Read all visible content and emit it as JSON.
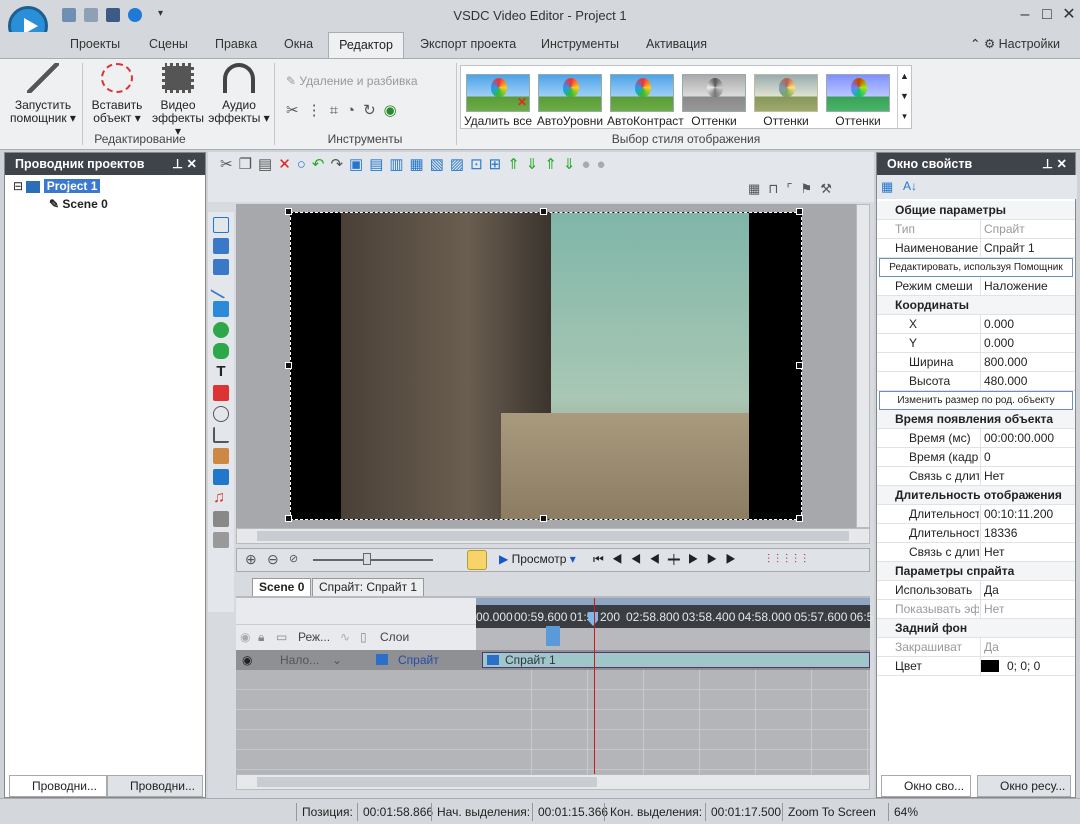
{
  "app": {
    "title": "VSDC Video Editor - Project 1"
  },
  "menu": {
    "tabs": [
      "Проекты",
      "Сцены",
      "Правка",
      "Окна",
      "Редактор",
      "Экспорт проекта",
      "Инструменты",
      "Активация"
    ],
    "settings": "Настройки"
  },
  "ribbon": {
    "wizard": "Запустить помощник",
    "insert": "Вставить объект",
    "video_fx": "Видео эффекты",
    "audio_fx": "Аудио эффекты",
    "group_edit": "Редактирование",
    "cut_split": "Удаление и разбивка",
    "group_tools": "Инструменты",
    "styles": [
      "Удалить все",
      "АвтоУровни",
      "АвтоКонтраст",
      "Оттенки",
      "Оттенки",
      "Оттенки"
    ],
    "group_styles": "Выбор стиля отображения"
  },
  "project_panel": {
    "title": "Проводник проектов",
    "root": "Project 1",
    "scene": "Scene 0",
    "tab1": "Проводни...",
    "tab2": "Проводни..."
  },
  "player": {
    "preview": "Просмотр"
  },
  "timeline": {
    "tab_scene": "Scene 0",
    "tab_sprite": "Спрайт: Спрайт 1",
    "ticks": [
      "00.000",
      "00:59.600",
      "01:5",
      "200",
      "02:58.800",
      "03:58.400",
      "04:58.000",
      "05:57.600",
      "06:5"
    ],
    "col_mode": "Реж...",
    "col_layers": "Слои",
    "track_blend": "Нало...",
    "track_name": "Спрайт",
    "clip": "Спрайт 1"
  },
  "properties": {
    "title": "Окно свойств",
    "rows": [
      {
        "type": "sec",
        "k": "Общие параметры"
      },
      {
        "type": "row",
        "k": "Тип",
        "v": "Спрайт",
        "dim": true
      },
      {
        "type": "row",
        "k": "Наименование",
        "v": "Спрайт 1"
      },
      {
        "type": "btn",
        "k": "Редактировать, используя Помощник"
      },
      {
        "type": "row",
        "k": "Режим смеши",
        "v": "Наложение"
      },
      {
        "type": "sec",
        "k": "Координаты"
      },
      {
        "type": "sub",
        "k": "X",
        "v": "0.000"
      },
      {
        "type": "sub",
        "k": "Y",
        "v": "0.000"
      },
      {
        "type": "sub",
        "k": "Ширина",
        "v": "800.000"
      },
      {
        "type": "sub",
        "k": "Высота",
        "v": "480.000"
      },
      {
        "type": "btn",
        "k": "Изменить размер по род. объекту"
      },
      {
        "type": "sec",
        "k": "Время появления объекта"
      },
      {
        "type": "sub",
        "k": "Время (мс)",
        "v": "00:00:00.000"
      },
      {
        "type": "sub",
        "k": "Время (кадр",
        "v": "0"
      },
      {
        "type": "sub",
        "k": "Связь с длит",
        "v": "Нет"
      },
      {
        "type": "sec",
        "k": "Длительность отображения"
      },
      {
        "type": "sub",
        "k": "Длительност",
        "v": "00:10:11.200"
      },
      {
        "type": "sub",
        "k": "Длительност",
        "v": "18336"
      },
      {
        "type": "sub",
        "k": "Связь с длит",
        "v": "Нет"
      },
      {
        "type": "sec",
        "k": "Параметры спрайта"
      },
      {
        "type": "row",
        "k": "Использовать",
        "v": "Да"
      },
      {
        "type": "row",
        "k": "Показывать эф",
        "v": "Нет",
        "dim": true
      },
      {
        "type": "sec",
        "k": "Задний фон"
      },
      {
        "type": "row",
        "k": "Закрашиват",
        "v": "Да",
        "dim": true
      },
      {
        "type": "row",
        "k": "Цвет",
        "v": "0; 0; 0"
      }
    ],
    "tab1": "Окно сво...",
    "tab2": "Окно ресу..."
  },
  "status": {
    "pos_label": "Позиция:",
    "pos": "00:01:58.866",
    "sel_start_label": "Нач. выделения:",
    "sel_start": "00:01:15.366",
    "sel_end_label": "Кон. выделения:",
    "sel_end": "00:01:17.500",
    "zoom_label": "Zoom To Screen",
    "zoom": "64%"
  },
  "colors": {
    "accent": "#3b78d0",
    "playhead": "#d01818",
    "clip": "#9fc7c8"
  }
}
